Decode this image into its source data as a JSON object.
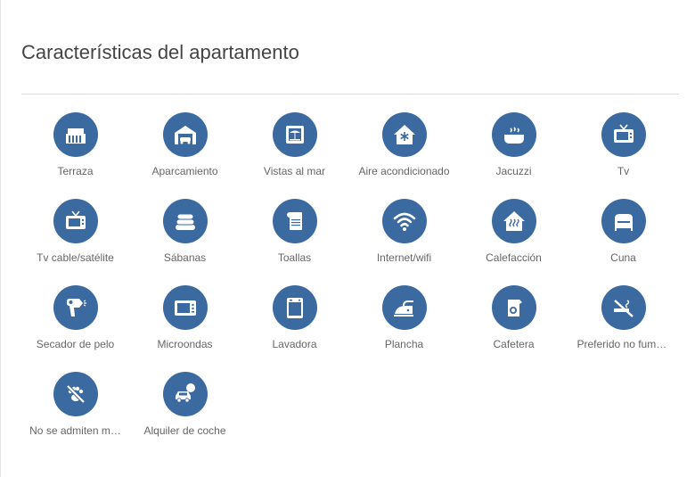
{
  "section": {
    "title": "Características del apartamento"
  },
  "colors": {
    "icon_circle": "#3b6aa0",
    "icon_glyph": "#ffffff",
    "label_text": "#666666",
    "title_text": "#444444"
  },
  "amenities": [
    {
      "label": "Terraza",
      "icon": "terrace-icon"
    },
    {
      "label": "Aparcamiento",
      "icon": "garage-icon"
    },
    {
      "label": "Vistas al mar",
      "icon": "sea-view-icon"
    },
    {
      "label": "Aire acondicionado",
      "icon": "air-conditioning-icon"
    },
    {
      "label": "Jacuzzi",
      "icon": "jacuzzi-icon"
    },
    {
      "label": "Tv",
      "icon": "tv-icon"
    },
    {
      "label": "Tv cable/satélite",
      "icon": "cable-tv-icon"
    },
    {
      "label": "Sábanas",
      "icon": "bed-sheets-icon"
    },
    {
      "label": "Toallas",
      "icon": "towels-icon"
    },
    {
      "label": "Internet/wifi",
      "icon": "wifi-icon"
    },
    {
      "label": "Calefacción",
      "icon": "heating-icon"
    },
    {
      "label": "Cuna",
      "icon": "crib-icon"
    },
    {
      "label": "Secador de pelo",
      "icon": "hair-dryer-icon"
    },
    {
      "label": "Microondas",
      "icon": "microwave-icon"
    },
    {
      "label": "Lavadora",
      "icon": "washing-machine-icon"
    },
    {
      "label": "Plancha",
      "icon": "iron-icon"
    },
    {
      "label": "Cafetera",
      "icon": "coffee-maker-icon"
    },
    {
      "label": "Preferido no fuma…",
      "icon": "no-smoking-icon"
    },
    {
      "label": "No se admiten m…",
      "icon": "no-pets-icon"
    },
    {
      "label": "Alquiler de coche",
      "icon": "car-rental-icon"
    }
  ]
}
